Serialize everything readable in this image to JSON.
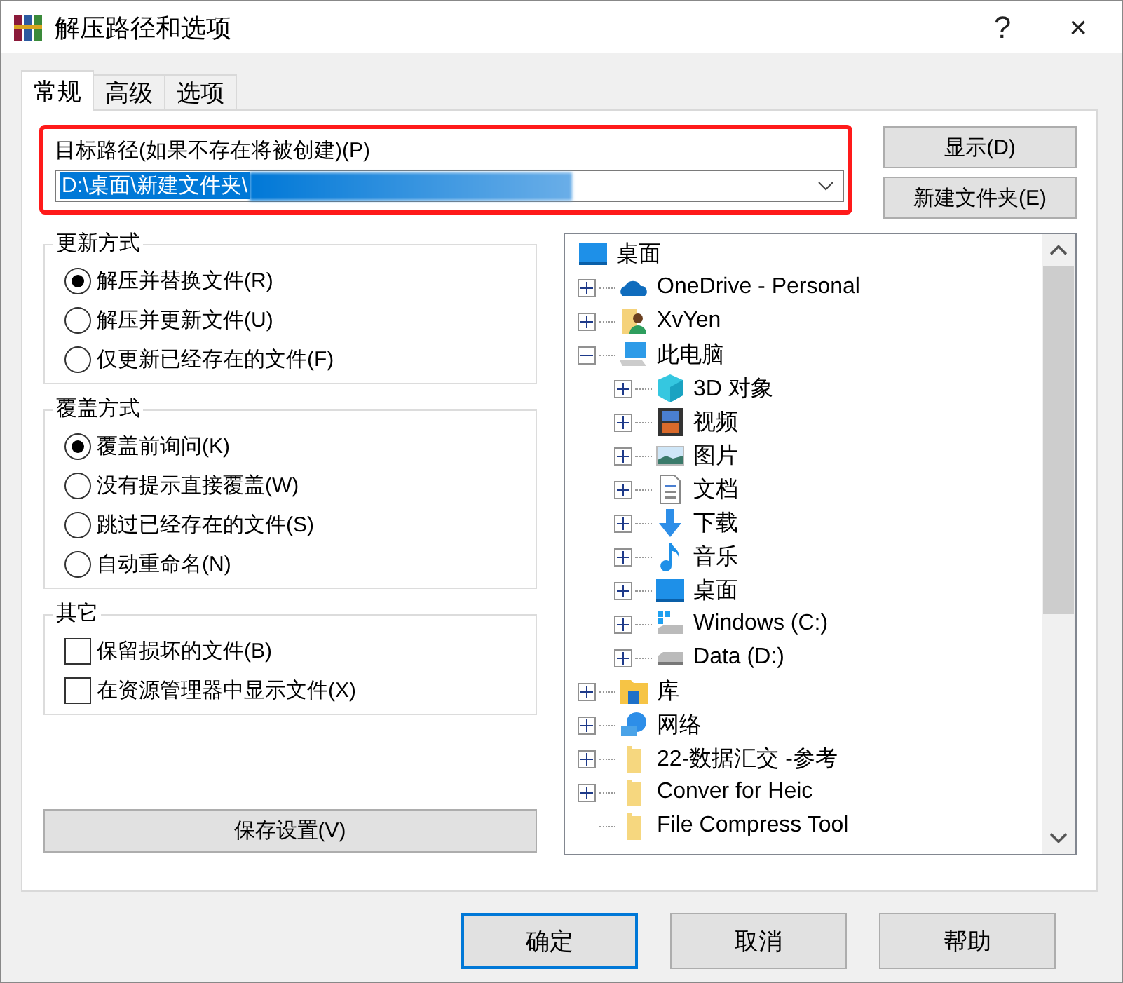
{
  "window": {
    "title": "解压路径和选项",
    "help": "?",
    "close": "×"
  },
  "tabs": [
    {
      "label": "常规",
      "selected": true
    },
    {
      "label": "高级",
      "selected": false
    },
    {
      "label": "选项",
      "selected": false
    }
  ],
  "destination": {
    "label": "目标路径(如果不存在将被创建)(P)",
    "value": "D:\\桌面\\新建文件夹\\",
    "highlighted": true
  },
  "side_buttons": [
    "显示(D)",
    "新建文件夹(E)"
  ],
  "groups": [
    {
      "title": "更新方式",
      "kind": "radio",
      "items": [
        {
          "label": "解压并替换文件(R)",
          "selected": true
        },
        {
          "label": "解压并更新文件(U)",
          "selected": false
        },
        {
          "label": "仅更新已经存在的文件(F)",
          "selected": false
        }
      ]
    },
    {
      "title": "覆盖方式",
      "kind": "radio",
      "items": [
        {
          "label": "覆盖前询问(K)",
          "selected": true
        },
        {
          "label": "没有提示直接覆盖(W)",
          "selected": false
        },
        {
          "label": "跳过已经存在的文件(S)",
          "selected": false
        },
        {
          "label": "自动重命名(N)",
          "selected": false
        }
      ]
    },
    {
      "title": "其它",
      "kind": "checkbox",
      "items": [
        {
          "label": "保留损坏的文件(B)",
          "checked": false
        },
        {
          "label": "在资源管理器中显示文件(X)",
          "checked": false
        }
      ]
    }
  ],
  "save_button": "保存设置(V)",
  "tree": {
    "root": {
      "label": "桌面",
      "kind": "desktop"
    },
    "items": [
      {
        "label": "OneDrive - Personal",
        "kind": "cloud",
        "expanded": false
      },
      {
        "label": "XvYen",
        "kind": "user",
        "expanded": false
      },
      {
        "label": "此电脑",
        "kind": "pc",
        "expanded": true,
        "children": [
          {
            "label": "3D 对象",
            "kind": "cube",
            "expanded": false
          },
          {
            "label": "视频",
            "kind": "video",
            "expanded": false
          },
          {
            "label": "图片",
            "kind": "image",
            "expanded": false
          },
          {
            "label": "文档",
            "kind": "document",
            "expanded": false
          },
          {
            "label": "下载",
            "kind": "download",
            "expanded": false
          },
          {
            "label": "音乐",
            "kind": "music",
            "expanded": false
          },
          {
            "label": "桌面",
            "kind": "desktop",
            "expanded": false
          },
          {
            "label": "Windows (C:)",
            "kind": "drive_win",
            "expanded": false
          },
          {
            "label": "Data (D:)",
            "kind": "drive",
            "expanded": false
          }
        ]
      },
      {
        "label": "库",
        "kind": "library",
        "expanded": false
      },
      {
        "label": "网络",
        "kind": "network",
        "expanded": false
      },
      {
        "label": "22-数据汇交 -参考",
        "kind": "folder",
        "expanded": false
      },
      {
        "label": "Conver for Heic",
        "kind": "folder",
        "expanded": false
      },
      {
        "label": "File Compress Tool",
        "kind": "folder"
      }
    ]
  },
  "footer_buttons": [
    {
      "label": "确定",
      "selected": true
    },
    {
      "label": "取消",
      "selected": false
    },
    {
      "label": "帮助",
      "selected": false
    }
  ]
}
